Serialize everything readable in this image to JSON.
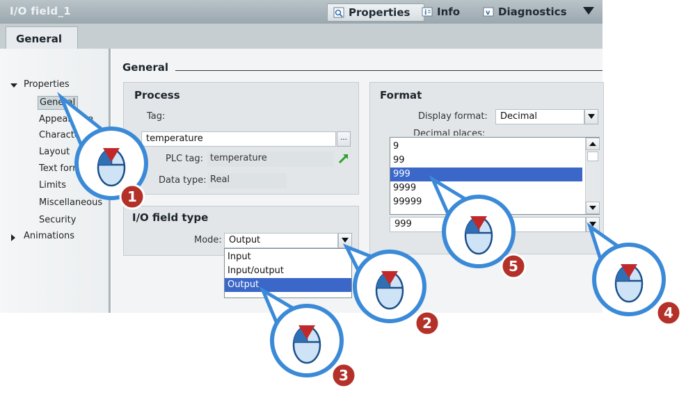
{
  "window": {
    "title": "I/O field_1",
    "tabs": [
      {
        "label": "Properties",
        "icon": "properties-icon"
      },
      {
        "label": "Info",
        "icon": "info-icon"
      },
      {
        "label": "Diagnostics",
        "icon": "diagnostics-icon"
      }
    ]
  },
  "subtabs": {
    "general": "General"
  },
  "nav": {
    "properties": "Properties",
    "items": [
      "General",
      "Appearance",
      "Characteristics",
      "Layout",
      "Text format",
      "Limits",
      "Miscellaneous",
      "Security"
    ],
    "animations": "Animations"
  },
  "main": {
    "title": "General",
    "process": {
      "title": "Process",
      "tag_label": "Tag:",
      "tag_value": "temperature",
      "browse_label": "...",
      "plc_tag_label": "PLC tag:",
      "plc_tag_value": "temperature",
      "data_type_label": "Data type:",
      "data_type_value": "Real"
    },
    "io_field": {
      "title": "I/O field type",
      "mode_label": "Mode:",
      "mode_value": "Output",
      "options": [
        "Input",
        "Input/output",
        "Output"
      ],
      "selected": "Output"
    },
    "format": {
      "title": "Format",
      "display_format_label": "Display format:",
      "display_format_value": "Decimal",
      "decimal_places_label": "Decimal places:",
      "pattern_options": [
        "9",
        "99",
        "999",
        "9999",
        "99999"
      ],
      "pattern_selected": "999",
      "pattern_value": "999"
    }
  },
  "callouts": [
    "1",
    "2",
    "3",
    "4",
    "5"
  ],
  "colors": {
    "callout_ring": "#3b8ad8",
    "callout_badge": "#b4312a",
    "selection": "#3a67c8"
  }
}
